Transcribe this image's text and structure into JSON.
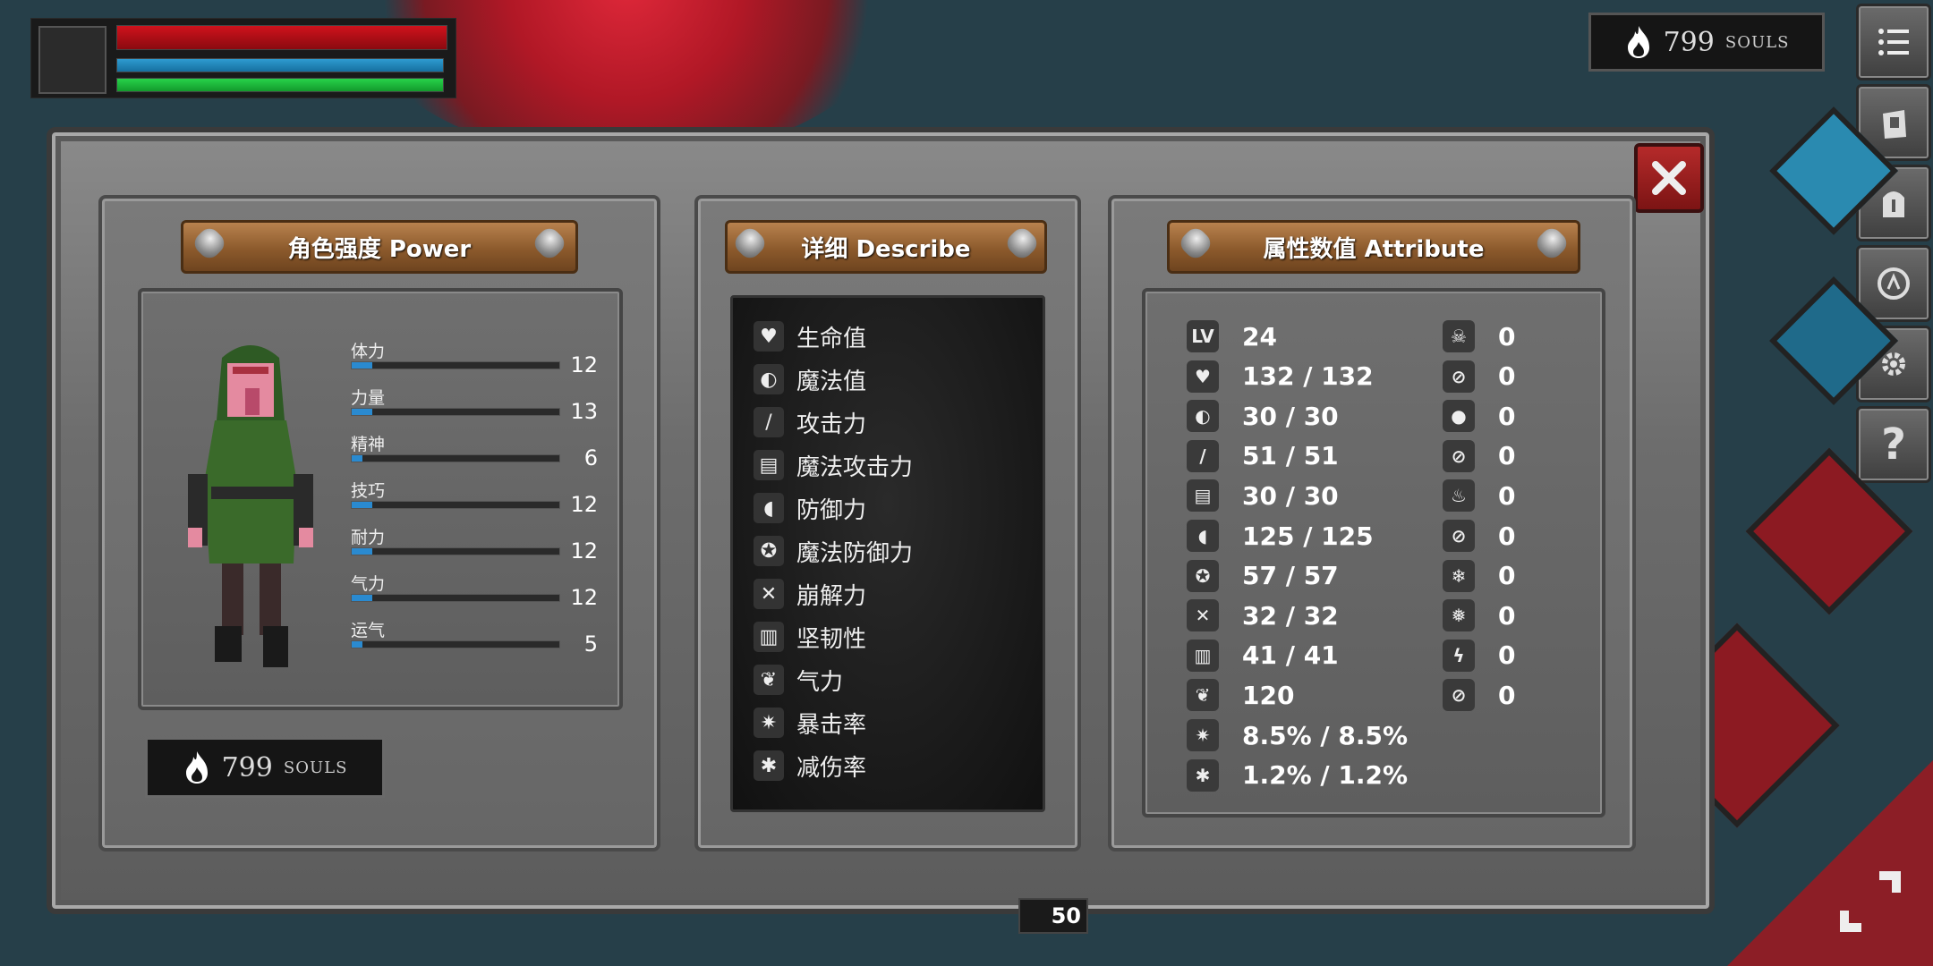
{
  "hud": {
    "souls_count": "799",
    "souls_word": "SOULS"
  },
  "panels": {
    "power": {
      "title": "角色强度 Power"
    },
    "describe": {
      "title": "详细 Describe"
    },
    "attribute": {
      "title": "属性数值 Attribute"
    }
  },
  "power_stats": [
    {
      "label": "体力",
      "value": "12",
      "level": 0.1
    },
    {
      "label": "力量",
      "value": "13",
      "level": 0.1
    },
    {
      "label": "精神",
      "value": "6",
      "level": 0.05
    },
    {
      "label": "技巧",
      "value": "12",
      "level": 0.1
    },
    {
      "label": "耐力",
      "value": "12",
      "level": 0.1
    },
    {
      "label": "气力",
      "value": "12",
      "level": 0.1
    },
    {
      "label": "运气",
      "value": "5",
      "level": 0.05
    }
  ],
  "souls_box": {
    "count": "799",
    "word": "SOULS"
  },
  "describe_items": [
    "生命值",
    "魔法值",
    "攻击力",
    "魔法攻击力",
    "防御力",
    "魔法防御力",
    "崩解力",
    "坚韧性",
    "气力",
    "暴击率",
    "减伤率"
  ],
  "attributes_left": [
    {
      "icon": "LV",
      "value": "24"
    },
    {
      "icon": "heart",
      "value": "132 / 132"
    },
    {
      "icon": "head",
      "value": "30 / 30"
    },
    {
      "icon": "sword",
      "value": "51 / 51"
    },
    {
      "icon": "spellbook",
      "value": "30 / 30"
    },
    {
      "icon": "shield",
      "value": "125 / 125"
    },
    {
      "icon": "magic-shield",
      "value": "57 / 57"
    },
    {
      "icon": "break",
      "value": "32 / 32"
    },
    {
      "icon": "helmet",
      "value": "41 / 41"
    },
    {
      "icon": "lungs",
      "value": "120"
    },
    {
      "icon": "crit",
      "value": "8.5% / 8.5%"
    },
    {
      "icon": "reduce",
      "value": "1.2% / 1.2%"
    }
  ],
  "attributes_right": [
    {
      "icon": "skull",
      "value": "0"
    },
    {
      "icon": "no-poison",
      "value": "0"
    },
    {
      "icon": "drop",
      "value": "0"
    },
    {
      "icon": "no-drop",
      "value": "0"
    },
    {
      "icon": "fire",
      "value": "0"
    },
    {
      "icon": "no-fire",
      "value": "0"
    },
    {
      "icon": "snowflake",
      "value": "0"
    },
    {
      "icon": "no-snowflake",
      "value": "0"
    },
    {
      "icon": "lightning",
      "value": "0"
    },
    {
      "icon": "no-lightning",
      "value": "0"
    }
  ],
  "bottom_counter": "50",
  "colors": {
    "hp": "#d0121c",
    "mp": "#2e9bd0",
    "stamina": "#27d24a",
    "close": "#b52a2a",
    "plank": "#a0693a"
  }
}
